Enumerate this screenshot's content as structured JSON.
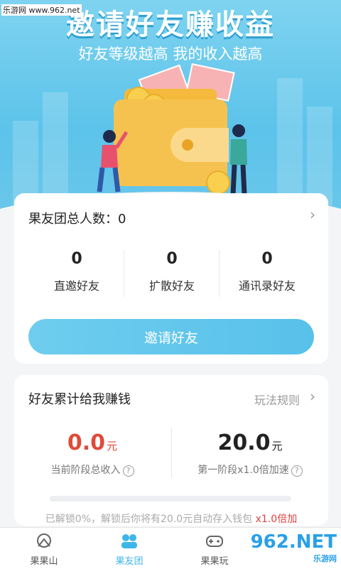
{
  "watermark": "乐游网 www.962.net",
  "hero": {
    "title": "邀请好友赚收益",
    "subtitle": "好友等级越高 我的收入越高"
  },
  "team": {
    "total_label": "果友团总人数：",
    "total_value": "0",
    "stats": [
      {
        "value": "0",
        "label": "直邀好友"
      },
      {
        "value": "0",
        "label": "扩散好友"
      },
      {
        "value": "0",
        "label": "通讯录好友"
      }
    ],
    "invite_button": "邀请好友"
  },
  "earnings": {
    "title": "好友累计给我赚钱",
    "rules_link": "玩法规则",
    "current": {
      "value": "0.0",
      "unit": "元",
      "caption": "当前阶段总收入"
    },
    "stage": {
      "value": "20.0",
      "unit": "元",
      "caption": "第一阶段x1.0倍加速"
    },
    "progress_percent": 0,
    "unlock_text": "已解锁0%，解锁后你将有20.0元自动存入钱包",
    "unlock_highlight": "x1.0倍加"
  },
  "tabs": [
    {
      "label": "果果山",
      "icon": "mountain-icon"
    },
    {
      "label": "果友团",
      "icon": "group-icon"
    },
    {
      "label": "果果玩",
      "icon": "gamepad-icon"
    }
  ],
  "logo": {
    "text": "962.NET",
    "subtext": "乐游网"
  },
  "colors": {
    "accent": "#5cc3ea",
    "red": "#e04a3a",
    "dark": "#222222"
  }
}
